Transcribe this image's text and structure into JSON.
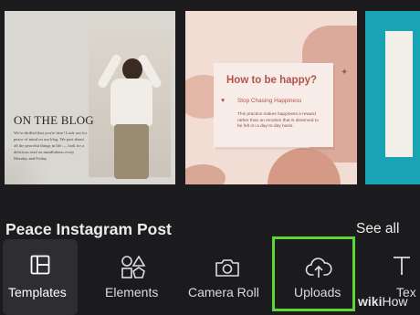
{
  "cards": [
    {
      "title": "ON THE BLOG",
      "body": "We're thrilled that you're here! Look out for peace of mind on our blog. We post about all the peaceful things in life — look for a delicious read on mindfulness every Monday and Friday."
    },
    {
      "title": "How to be happy?",
      "subtitle": "Stop Chasing Happiness",
      "body": "This practice makes happiness a reward rather than an emotion that is deserved to be felt on a day-to-day basis."
    },
    {}
  ],
  "section": {
    "title": "Peace Instagram Post",
    "see_all": "See all"
  },
  "nav": {
    "items": [
      {
        "label": "Templates",
        "icon": "templates-icon",
        "active": true
      },
      {
        "label": "Elements",
        "icon": "elements-icon"
      },
      {
        "label": "Camera Roll",
        "icon": "camera-icon"
      },
      {
        "label": "Uploads",
        "icon": "upload-cloud-icon",
        "highlighted": true
      },
      {
        "label": "Tex",
        "icon": "text-icon"
      }
    ]
  },
  "watermark": {
    "bold": "wiki",
    "text": "How"
  },
  "colors": {
    "background": "#1c1c1f",
    "highlight": "#5ed633",
    "accent_happy": "#b2534a",
    "teal": "#1aa3b4"
  }
}
